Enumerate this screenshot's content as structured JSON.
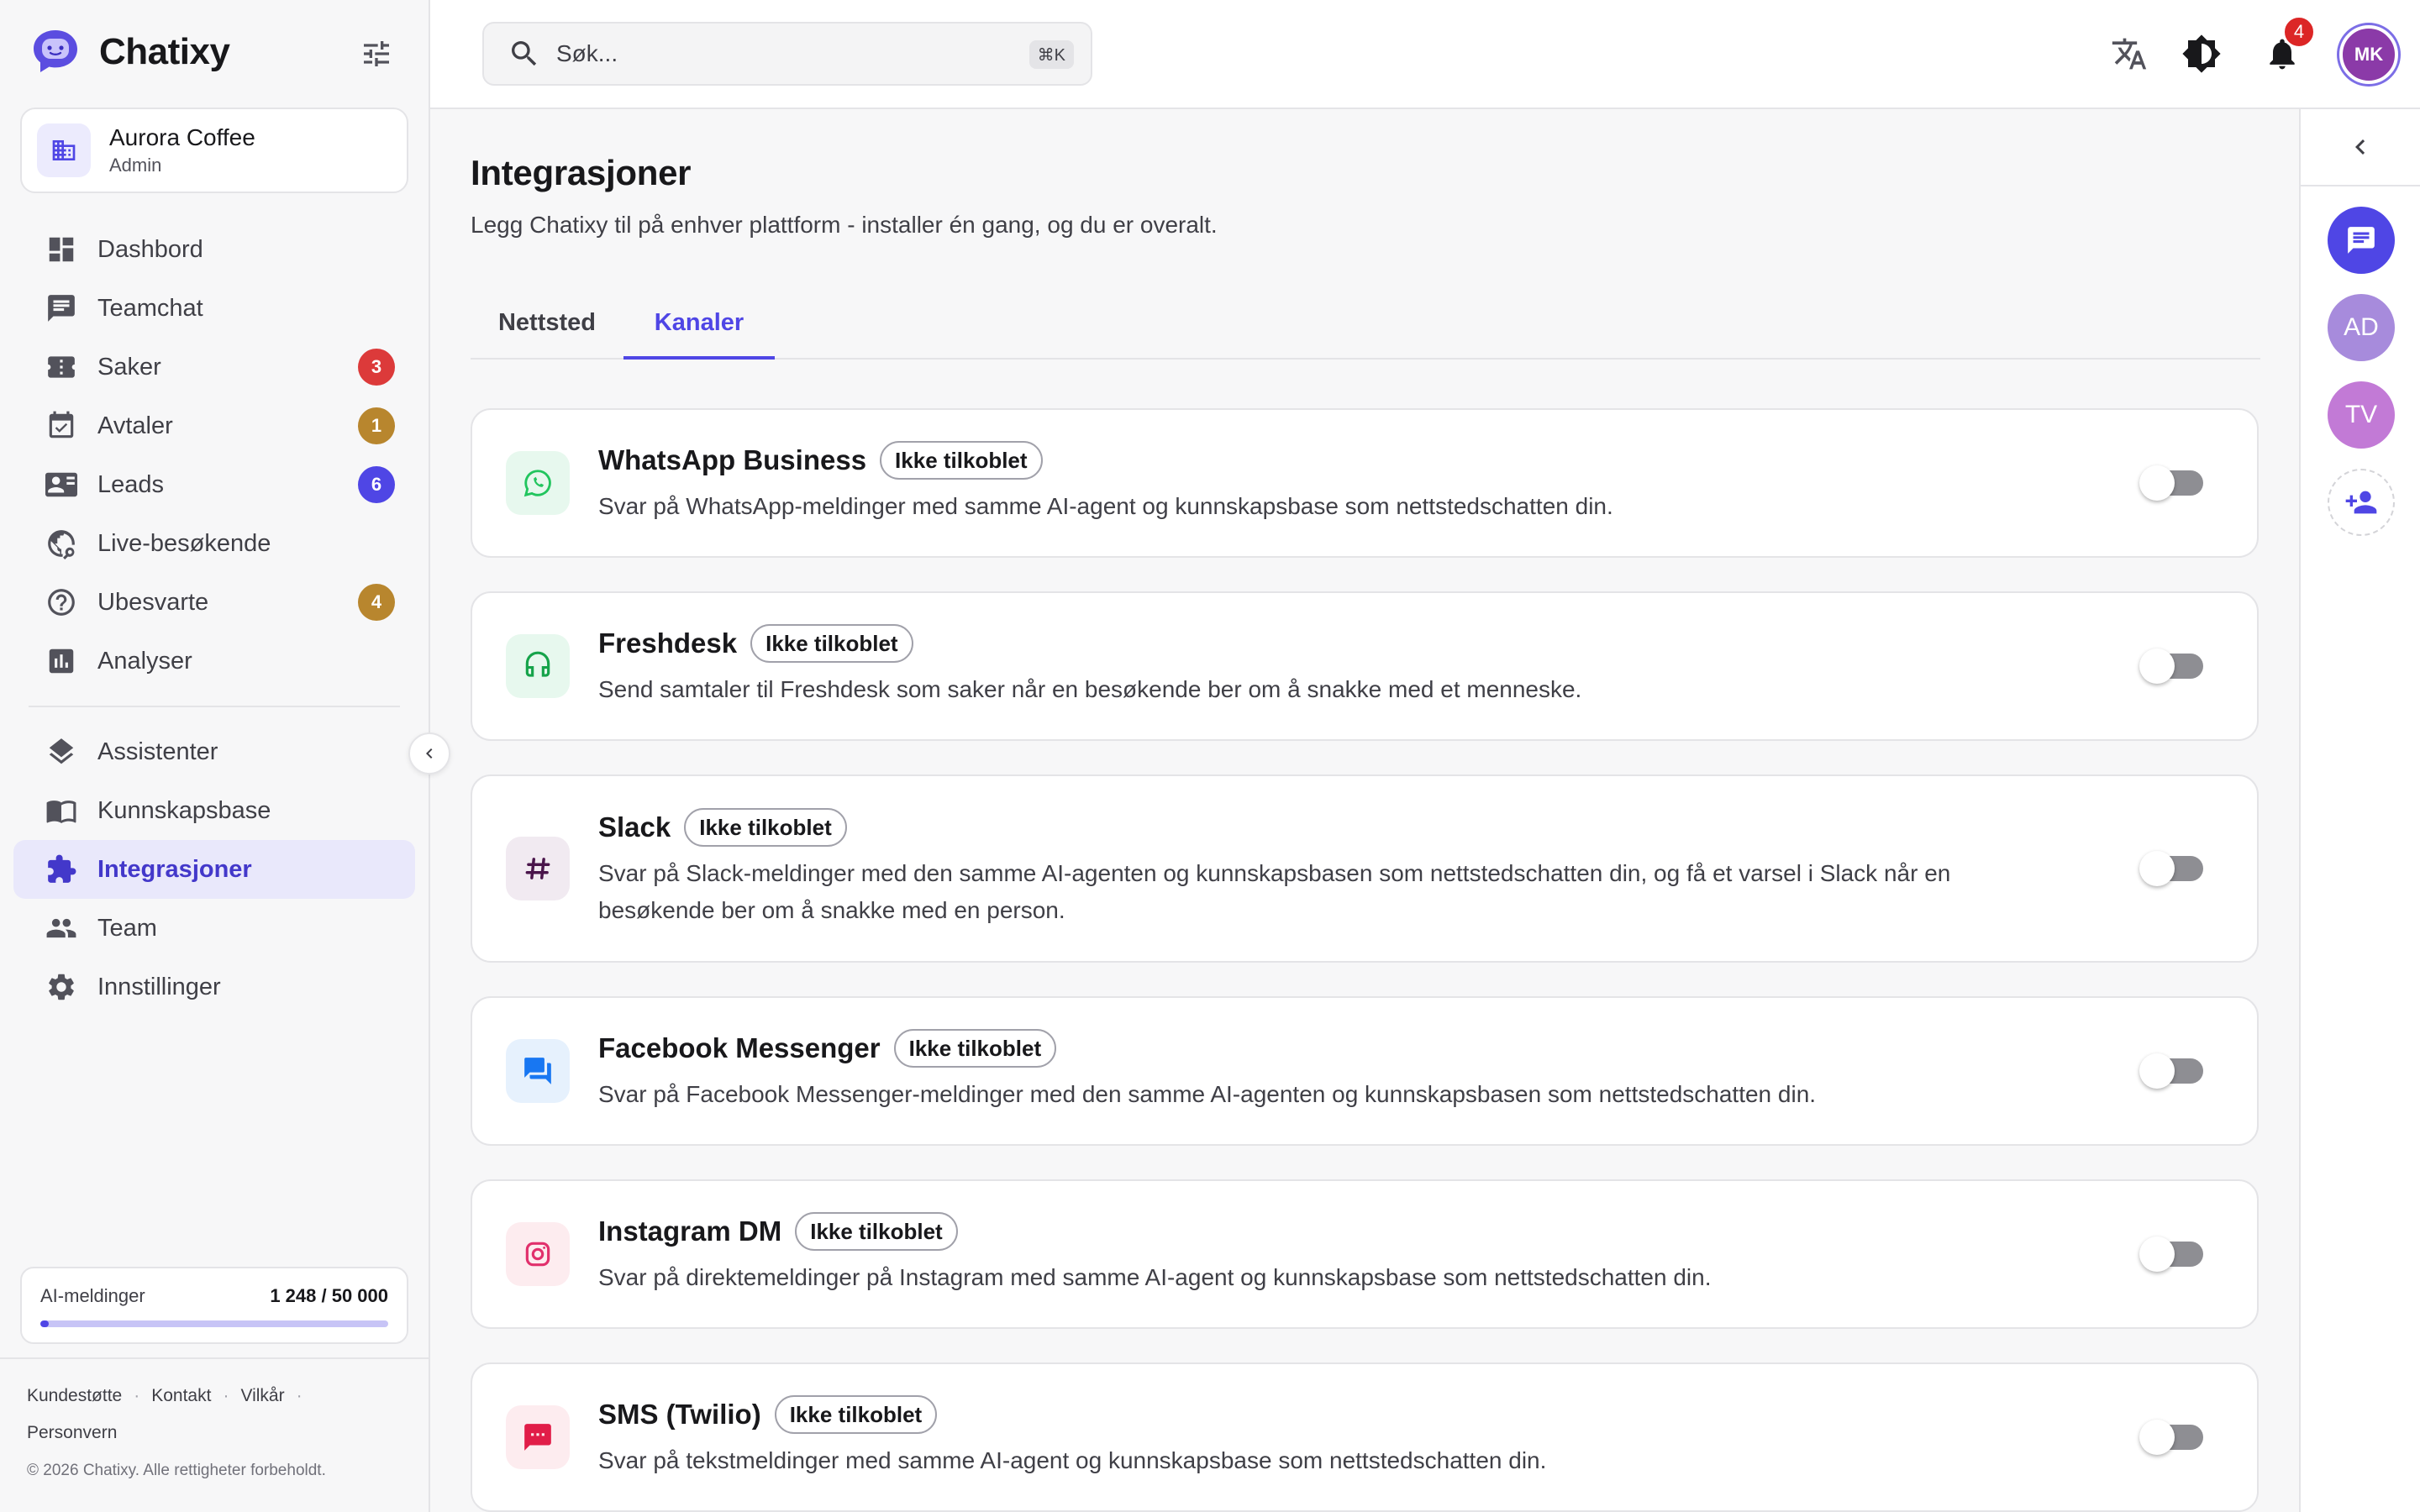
{
  "brand": {
    "name": "Chatixy"
  },
  "org": {
    "name": "Aurora Coffee",
    "role": "Admin"
  },
  "nav": {
    "items": [
      {
        "label": "Dashbord",
        "icon": "dashboard-icon"
      },
      {
        "label": "Teamchat",
        "icon": "chat-icon"
      },
      {
        "label": "Saker",
        "icon": "ticket-icon",
        "badge": "3",
        "badge_color": "#dc3a3a"
      },
      {
        "label": "Avtaler",
        "icon": "calendar-icon",
        "badge": "1",
        "badge_color": "#b8862e"
      },
      {
        "label": "Leads",
        "icon": "contact-card-icon",
        "badge": "6",
        "badge_color": "#4f46e5"
      },
      {
        "label": "Live-besøkende",
        "icon": "visitors-icon"
      },
      {
        "label": "Ubesvarte",
        "icon": "question-icon",
        "badge": "4",
        "badge_color": "#b8862e"
      },
      {
        "label": "Analyser",
        "icon": "analytics-icon"
      }
    ],
    "items2": [
      {
        "label": "Assistenter",
        "icon": "layers-icon"
      },
      {
        "label": "Kunnskapsbase",
        "icon": "book-icon"
      },
      {
        "label": "Integrasjoner",
        "icon": "puzzle-icon",
        "active": true
      },
      {
        "label": "Team",
        "icon": "team-icon"
      },
      {
        "label": "Innstillinger",
        "icon": "gear-icon"
      }
    ]
  },
  "usage": {
    "label": "AI-meldinger",
    "value": "1 248 / 50 000",
    "fraction": 0.025
  },
  "footer": {
    "links": [
      "Kundestøtte",
      "Kontakt",
      "Vilkår",
      "Personvern"
    ],
    "copyright": "© 2026 Chatixy. Alle rettigheter forbeholdt."
  },
  "search": {
    "placeholder": "Søk...",
    "shortcut": "⌘K"
  },
  "topbar": {
    "notifications": "4",
    "avatar_initials": "MK"
  },
  "page": {
    "title": "Integrasjoner",
    "subtitle": "Legg Chatixy til på enhver plattform - installer én gang, og du er overalt.",
    "tabs": [
      {
        "label": "Nettsted",
        "active": false
      },
      {
        "label": "Kanaler",
        "active": true
      }
    ]
  },
  "integrations": [
    {
      "title": "WhatsApp Business",
      "status": "Ikke tilkoblet",
      "desc": "Svar på WhatsApp-meldinger med samme AI-agent og kunnskapsbase som nettstedschatten din.",
      "icon": "whatsapp-icon",
      "icon_bg": "#e7f8ee",
      "icon_color": "#22c55e",
      "enabled": false
    },
    {
      "title": "Freshdesk",
      "status": "Ikke tilkoblet",
      "desc": "Send samtaler til Freshdesk som saker når en besøkende ber om å snakke med et menneske.",
      "icon": "headset-icon",
      "icon_bg": "#e7f8ee",
      "icon_color": "#16a34a",
      "enabled": false
    },
    {
      "title": "Slack",
      "status": "Ikke tilkoblet",
      "desc": "Svar på Slack-meldinger med den samme AI-agenten og kunnskapsbasen som nettstedschatten din, og få et varsel i Slack når en besøkende ber om å snakke med en person.",
      "icon": "hashtag-icon",
      "icon_bg": "#f1eaf1",
      "icon_color": "#4a154b",
      "enabled": false
    },
    {
      "title": "Facebook Messenger",
      "status": "Ikke tilkoblet",
      "desc": "Svar på Facebook Messenger-meldinger med den samme AI-agenten og kunnskapsbasen som nettstedschatten din.",
      "icon": "messenger-icon",
      "icon_bg": "#e6f1fd",
      "icon_color": "#1877f2",
      "enabled": false
    },
    {
      "title": "Instagram DM",
      "status": "Ikke tilkoblet",
      "desc": "Svar på direktemeldinger på Instagram med samme AI-agent og kunnskapsbase som nettstedschatten din.",
      "icon": "instagram-icon",
      "icon_bg": "#fdecef",
      "icon_color": "#e1306c",
      "enabled": false
    },
    {
      "title": "SMS (Twilio)",
      "status": "Ikke tilkoblet",
      "desc": "Svar på tekstmeldinger med samme AI-agent og kunnskapsbase som nettstedschatten din.",
      "icon": "sms-icon",
      "icon_bg": "#fdecef",
      "icon_color": "#e11d48",
      "enabled": false
    }
  ],
  "rail": {
    "buttons": [
      {
        "label": "",
        "icon": "chat-bubble-icon",
        "color": "#4f46e5"
      },
      {
        "label": "AD",
        "color": "#a78bdc"
      },
      {
        "label": "TV",
        "color": "#c27ad6"
      },
      {
        "label": "",
        "icon": "add-user-icon"
      }
    ]
  },
  "colors": {
    "accent": "#4f46e5",
    "danger": "#dc2626"
  }
}
